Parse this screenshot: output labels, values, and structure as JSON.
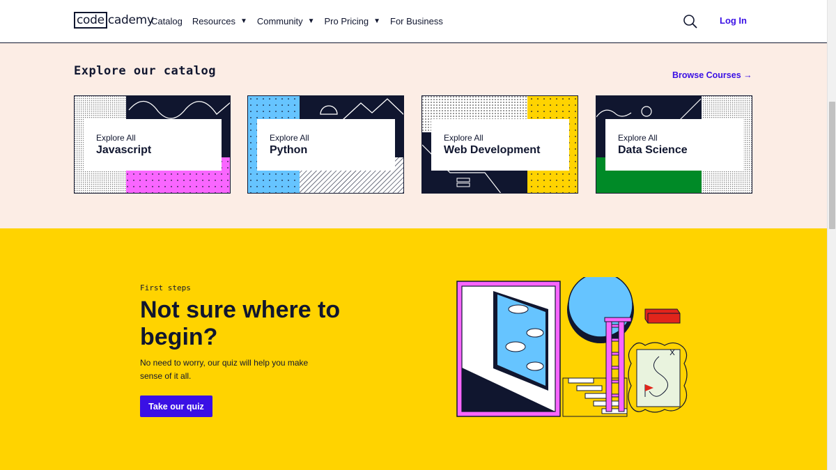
{
  "nav": {
    "logo_box": "code",
    "logo_rest": "cademy",
    "links": [
      {
        "label": "Catalog",
        "dropdown": false
      },
      {
        "label": "Resources",
        "dropdown": true
      },
      {
        "label": "Community",
        "dropdown": true
      },
      {
        "label": "Pro Pricing",
        "dropdown": true
      },
      {
        "label": "For Business",
        "dropdown": false
      }
    ],
    "caret": "▼",
    "search_icon": "search-icon",
    "login_label": "Log In"
  },
  "catalog": {
    "title": "Explore our catalog",
    "browse_label": "Browse Courses →",
    "cards": [
      {
        "subtitle": "Explore All",
        "title": "Javascript",
        "accent": "#f966ff"
      },
      {
        "subtitle": "Explore All",
        "title": "Python",
        "accent": "#66c4ff"
      },
      {
        "subtitle": "Explore All",
        "title": "Web Development",
        "accent": "#ffd300"
      },
      {
        "subtitle": "Explore All",
        "title": "Data Science",
        "accent": "#008a27"
      }
    ]
  },
  "first_steps": {
    "eyebrow": "First steps",
    "headline": "Not sure where to begin?",
    "description": "No need to worry, our quiz will help you make sense of it all.",
    "button_label": "Take our quiz"
  },
  "colors": {
    "brand_blue": "#3a10e5",
    "navy": "#10162f",
    "catalog_bg": "#fcede5",
    "quiz_bg": "#ffd300"
  }
}
